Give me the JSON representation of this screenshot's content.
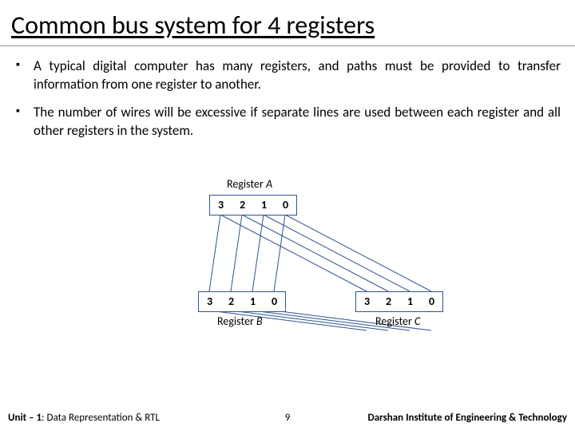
{
  "title": "Common bus system for 4 registers",
  "bullets": [
    "A typical digital computer has many registers, and paths must be provided to transfer information from one register to another.",
    "The number of wires will be excessive if separate lines are used between each register and all other registers in the system."
  ],
  "diagram": {
    "regA": {
      "label_prefix": "Register ",
      "label_italic": "A",
      "cells": [
        "3",
        "2",
        "1",
        "0"
      ]
    },
    "regB": {
      "label_prefix": "Register ",
      "label_italic": "B",
      "cells": [
        "3",
        "2",
        "1",
        "0"
      ]
    },
    "regC": {
      "label_prefix": "Register ",
      "label_italic": "C",
      "cells": [
        "3",
        "2",
        "1",
        "0"
      ]
    }
  },
  "footer": {
    "unit": "Unit – 1",
    "rest": ": Data Representation & RTL",
    "page": "9",
    "institute": "Darshan Institute of Engineering & Technology"
  }
}
